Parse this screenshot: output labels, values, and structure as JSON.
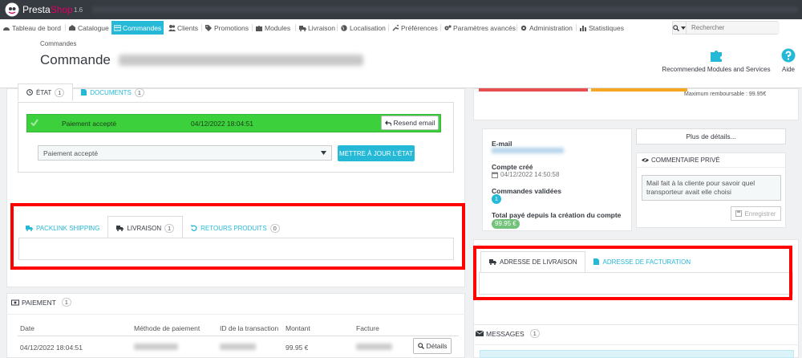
{
  "brand": {
    "name_part1": "Presta",
    "name_part2": "Shop",
    "version": "1.6"
  },
  "nav": {
    "items": [
      {
        "label": "Tableau de bord",
        "icon": "dashboard-icon"
      },
      {
        "label": "Catalogue",
        "icon": "catalog-icon"
      },
      {
        "label": "Commandes",
        "icon": "credit-card-icon",
        "active": true
      },
      {
        "label": "Clients",
        "icon": "users-icon"
      },
      {
        "label": "Promotions",
        "icon": "tag-icon"
      },
      {
        "label": "Modules",
        "icon": "puzzle-icon"
      },
      {
        "label": "Livraison",
        "icon": "truck-icon"
      },
      {
        "label": "Localisation",
        "icon": "globe-icon"
      },
      {
        "label": "Préférences",
        "icon": "wrench-icon"
      },
      {
        "label": "Paramètres avancés",
        "icon": "cogs-icon"
      },
      {
        "label": "Administration",
        "icon": "gear-icon"
      },
      {
        "label": "Statistiques",
        "icon": "chart-icon"
      }
    ]
  },
  "search": {
    "placeholder": "Rechercher"
  },
  "header": {
    "breadcrumb": "Commandes",
    "title": "Commande",
    "toolbar": {
      "recommended_label": "Recommended Modules and Services",
      "help_label": "Aide"
    }
  },
  "state_panel": {
    "tabs": [
      {
        "label": "État",
        "count": "1"
      },
      {
        "label": "Documents",
        "count": "1"
      }
    ],
    "current_status": "Paiement accepté",
    "current_status_date": "04/12/2022 18:04:51",
    "resend_label": "Resend email",
    "select_value": "Paiement accepté",
    "update_label": "Mettre à jour l'état"
  },
  "shipping_panel": {
    "tabs": [
      {
        "label": "Packlink Shipping",
        "count": ""
      },
      {
        "label": "Livraison",
        "count": "1"
      },
      {
        "label": "Retours produits",
        "count": "0"
      }
    ]
  },
  "payment_panel": {
    "title": "Paiement",
    "count": "1",
    "columns": [
      "Date",
      "Méthode de paiement",
      "ID de la transaction",
      "Montant",
      "Facture"
    ],
    "row": {
      "date": "04/12/2022 18:04:51",
      "amount": "99.95 €"
    },
    "details_label": "Détails"
  },
  "refund": {
    "max_text": "Maximum remboursable : 99.95€"
  },
  "customer": {
    "email_label": "E-mail",
    "created_label": "Compte créé",
    "created_value": "04/12/2022 14:50:58",
    "orders_label": "Commandes validées",
    "orders_count": "1",
    "total_label": "Total payé depuis la création du compte",
    "total_value": "99.95 €"
  },
  "more_details_label": "Plus de détails...",
  "private_comment": {
    "title": "Commentaire privé",
    "text": "Mail fait à la cliente pour savoir quel transporteur avait elle choisi",
    "save_label": "Enregistrer"
  },
  "address_panel": {
    "tabs": [
      {
        "label": "Adresse de livraison"
      },
      {
        "label": "Adresse de facturation"
      }
    ]
  },
  "messages_panel": {
    "title": "Messages",
    "count": "1"
  },
  "colors": {
    "accent": "#25b9d7",
    "success": "#3cd13c",
    "highlight_frame": "#ff0000",
    "topbar": "#363a41"
  }
}
